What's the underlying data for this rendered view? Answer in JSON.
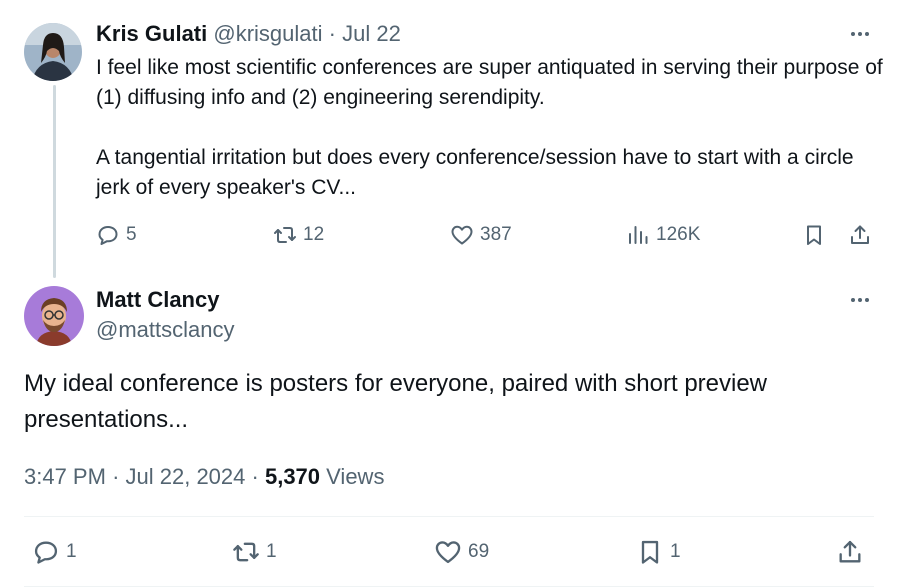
{
  "parent": {
    "author_name": "Kris Gulati",
    "handle": "@krisgulati",
    "separator": "·",
    "date": "Jul 22",
    "text": "I feel like most scientific conferences are super antiquated in serving their purpose of (1) diffusing info and (2) engineering serendipity.\n\nA tangential irritation but does every conference/session have to start with a circle jerk of every speaker's CV...",
    "replies": "5",
    "reposts": "12",
    "likes": "387",
    "views": "126K"
  },
  "main": {
    "author_name": "Matt Clancy",
    "handle": "@mattsclancy",
    "text": "My ideal conference is posters for everyone, paired with short preview presentations...",
    "time": "3:47 PM",
    "sep1": "·",
    "date": "Jul 22, 2024",
    "sep2": "·",
    "views_count": "5,370",
    "views_label": "Views",
    "replies": "1",
    "reposts": "1",
    "likes": "69",
    "bookmarks": "1"
  },
  "icons": {
    "reply": "reply-icon",
    "repost": "repost-icon",
    "like": "heart-icon",
    "views": "analytics-icon",
    "bookmark": "bookmark-icon",
    "share": "share-icon",
    "more": "more-icon"
  },
  "colors": {
    "text": "#0f1419",
    "muted": "#536471",
    "thread_line": "#cfd9de",
    "matt_avatar_bg": "#a77bd9"
  }
}
